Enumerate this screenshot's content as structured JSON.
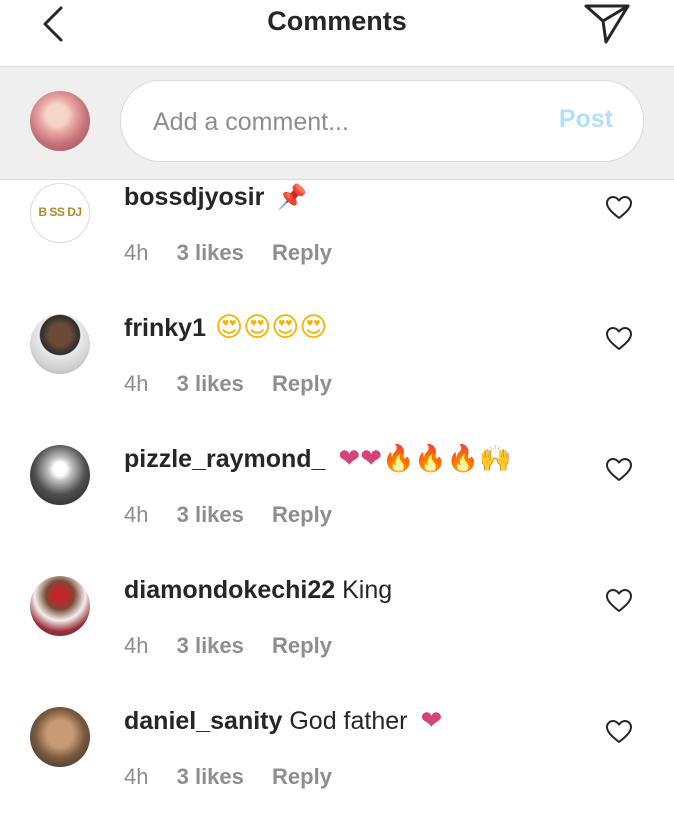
{
  "header": {
    "title": "Comments",
    "back_icon": "chevron-left-icon",
    "send_icon": "paper-plane-icon"
  },
  "composer": {
    "placeholder": "Add a comment...",
    "post_label": "Post",
    "post_color": "#b2dffc"
  },
  "comments": [
    {
      "username": "bossdjyosir",
      "text": "",
      "emoji": "📌",
      "emoji_icon": "pushpin-icon",
      "avatar_text": "B SS DJ",
      "time": "4h",
      "likes": "3 likes",
      "reply": "Reply"
    },
    {
      "username": "frinky1",
      "text": "",
      "emoji": "😍😍😍😍",
      "emoji_icon": "heart-eyes-smiley-icon",
      "time": "4h",
      "likes": "3 likes",
      "reply": "Reply"
    },
    {
      "username": "pizzle_raymond_",
      "text": "",
      "emoji": "❤❤🔥🔥🔥🙌",
      "emoji_icon": "hearts-fire-raised-hands-icon",
      "time": "4h",
      "likes": "3 likes",
      "reply": "Reply"
    },
    {
      "username": "diamondokechi22",
      "text": "King",
      "emoji": "",
      "time": "4h",
      "likes": "3 likes",
      "reply": "Reply"
    },
    {
      "username": "daniel_sanity",
      "text": "God father",
      "emoji": "❤",
      "emoji_icon": "heart-icon",
      "time": "4h",
      "likes": "3 likes",
      "reply": "Reply"
    }
  ],
  "colors": {
    "text": "#262626",
    "secondary_text": "#8e8e8e",
    "composer_bg": "#efefef",
    "divider": "#dbdbdb"
  }
}
